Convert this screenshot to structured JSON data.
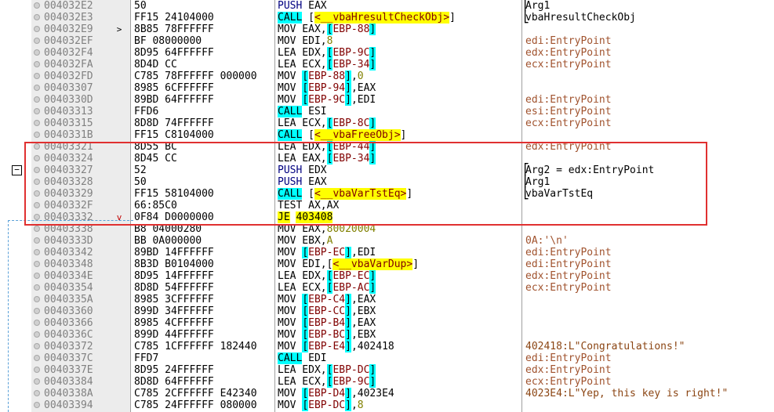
{
  "rows": [
    {
      "addr": "004032E2",
      "marker": "",
      "bytes": "50",
      "instr": [
        [
          "k-push",
          "PUSH"
        ],
        [
          "p",
          " EAX"
        ]
      ],
      "comment": "Arg1",
      "ctype": "arg",
      "brace": "top"
    },
    {
      "addr": "004032E3",
      "marker": "",
      "bytes": "FF15 24104000",
      "instr": [
        [
          "k-call",
          "CALL"
        ],
        [
          "p",
          " ["
        ],
        [
          "op-call",
          "<__vbaHresultCheckObj>"
        ],
        [
          "p",
          "]"
        ]
      ],
      "comment": "vbaHresultCheckObj",
      "ctype": "arg",
      "brace": "bottom"
    },
    {
      "addr": "004032E9",
      "marker": ">",
      "bytes": "8B85 78FFFFFF",
      "instr": [
        [
          "k-mov",
          "MOV"
        ],
        [
          "p",
          " EAX,"
        ],
        [
          "op-mem",
          "["
        ],
        [
          "op-ref",
          "EBP-88"
        ],
        [
          "op-mem",
          "]"
        ]
      ],
      "comment": "",
      "ctype": "reg"
    },
    {
      "addr": "004032EF",
      "marker": "",
      "bytes": "BF 08000000",
      "instr": [
        [
          "k-mov",
          "MOV"
        ],
        [
          "p",
          " EDI,"
        ],
        [
          "op-num",
          "8"
        ]
      ],
      "comment": "edi:EntryPoint",
      "ctype": "reg"
    },
    {
      "addr": "004032F4",
      "marker": "",
      "bytes": "8D95 64FFFFFF",
      "instr": [
        [
          "k-lea",
          "LEA"
        ],
        [
          "p",
          " EDX,"
        ],
        [
          "op-mem",
          "["
        ],
        [
          "op-ref",
          "EBP-9C"
        ],
        [
          "op-mem",
          "]"
        ]
      ],
      "comment": "edx:EntryPoint",
      "ctype": "reg"
    },
    {
      "addr": "004032FA",
      "marker": "",
      "bytes": "8D4D CC",
      "instr": [
        [
          "k-lea",
          "LEA"
        ],
        [
          "p",
          " ECX,"
        ],
        [
          "op-mem",
          "["
        ],
        [
          "op-ref",
          "EBP-34"
        ],
        [
          "op-mem",
          "]"
        ]
      ],
      "comment": "ecx:EntryPoint",
      "ctype": "reg"
    },
    {
      "addr": "004032FD",
      "marker": "",
      "bytes": "C785 78FFFFFF 000000",
      "instr": [
        [
          "k-mov",
          "MOV"
        ],
        [
          "p",
          " "
        ],
        [
          "op-mem",
          "["
        ],
        [
          "op-ref",
          "EBP-88"
        ],
        [
          "op-mem",
          "]"
        ],
        [
          "p",
          ","
        ],
        [
          "op-num",
          "0"
        ]
      ],
      "comment": "",
      "ctype": "reg"
    },
    {
      "addr": "00403307",
      "marker": "",
      "bytes": "8985 6CFFFFFF",
      "instr": [
        [
          "k-mov",
          "MOV"
        ],
        [
          "p",
          " "
        ],
        [
          "op-mem",
          "["
        ],
        [
          "op-ref",
          "EBP-94"
        ],
        [
          "op-mem",
          "]"
        ],
        [
          "p",
          ",EAX"
        ]
      ],
      "comment": "",
      "ctype": "reg"
    },
    {
      "addr": "0040330D",
      "marker": "",
      "bytes": "89BD 64FFFFFF",
      "instr": [
        [
          "k-mov",
          "MOV"
        ],
        [
          "p",
          " "
        ],
        [
          "op-mem",
          "["
        ],
        [
          "op-ref",
          "EBP-9C"
        ],
        [
          "op-mem",
          "]"
        ],
        [
          "p",
          ",EDI"
        ]
      ],
      "comment": "edi:EntryPoint",
      "ctype": "reg"
    },
    {
      "addr": "00403313",
      "marker": "",
      "bytes": "FFD6",
      "instr": [
        [
          "k-call",
          "CALL"
        ],
        [
          "p",
          " ESI"
        ]
      ],
      "comment": "esi:EntryPoint",
      "ctype": "reg"
    },
    {
      "addr": "00403315",
      "marker": "",
      "bytes": "8D8D 74FFFFFF",
      "instr": [
        [
          "k-lea",
          "LEA"
        ],
        [
          "p",
          " ECX,"
        ],
        [
          "op-mem",
          "["
        ],
        [
          "op-ref",
          "EBP-8C"
        ],
        [
          "op-mem",
          "]"
        ]
      ],
      "comment": "ecx:EntryPoint",
      "ctype": "reg"
    },
    {
      "addr": "0040331B",
      "marker": "",
      "bytes": "FF15 C8104000",
      "instr": [
        [
          "k-call",
          "CALL"
        ],
        [
          "p",
          " ["
        ],
        [
          "op-call",
          "<__vbaFreeObj>"
        ],
        [
          "p",
          "]"
        ]
      ],
      "comment": "",
      "ctype": "reg"
    },
    {
      "addr": "00403321",
      "marker": "",
      "bytes": "8D55 BC",
      "instr": [
        [
          "k-lea",
          "LEA"
        ],
        [
          "p",
          " EDX,"
        ],
        [
          "op-mem",
          "["
        ],
        [
          "op-ref",
          "EBP-44"
        ],
        [
          "op-mem",
          "]"
        ]
      ],
      "comment": "edx:EntryPoint",
      "ctype": "reg"
    },
    {
      "addr": "00403324",
      "marker": "",
      "bytes": "8D45 CC",
      "instr": [
        [
          "k-lea",
          "LEA"
        ],
        [
          "p",
          " EAX,"
        ],
        [
          "op-mem",
          "["
        ],
        [
          "op-ref",
          "EBP-34"
        ],
        [
          "op-mem",
          "]"
        ]
      ],
      "comment": "",
      "ctype": "reg"
    },
    {
      "addr": "00403327",
      "marker": "",
      "bytes": "52",
      "instr": [
        [
          "k-push",
          "PUSH"
        ],
        [
          "p",
          " EDX"
        ]
      ],
      "comment": "Arg2 = edx:EntryPoint",
      "ctype": "arg",
      "brace": "top"
    },
    {
      "addr": "00403328",
      "marker": "",
      "bytes": "50",
      "instr": [
        [
          "k-push",
          "PUSH"
        ],
        [
          "p",
          " EAX"
        ]
      ],
      "comment": "Arg1",
      "ctype": "arg",
      "brace": "mid"
    },
    {
      "addr": "00403329",
      "marker": "",
      "bytes": "FF15 58104000",
      "instr": [
        [
          "k-call",
          "CALL"
        ],
        [
          "p",
          " ["
        ],
        [
          "op-call",
          "<__vbaVarTstEq>"
        ],
        [
          "p",
          "]"
        ]
      ],
      "comment": "vbaVarTstEq",
      "ctype": "arg",
      "brace": "bottom"
    },
    {
      "addr": "0040332F",
      "marker": "",
      "bytes": "66:85C0",
      "instr": [
        [
          "k-test",
          "TEST"
        ],
        [
          "p",
          " AX,AX"
        ]
      ],
      "comment": "",
      "ctype": "reg"
    },
    {
      "addr": "00403332",
      "marker": "v",
      "bytes": "0F84 D0000000",
      "instr": [
        [
          "k-je",
          "JE"
        ],
        [
          "p",
          " "
        ],
        [
          "op-jaddr",
          "403408"
        ]
      ],
      "comment": "",
      "ctype": "reg"
    },
    {
      "addr": "00403338",
      "marker": "",
      "bytes": "B8 04000280",
      "instr": [
        [
          "k-mov",
          "MOV"
        ],
        [
          "p",
          " EAX,"
        ],
        [
          "op-num",
          "80020004"
        ]
      ],
      "comment": "",
      "ctype": "reg"
    },
    {
      "addr": "0040333D",
      "marker": "",
      "bytes": "BB 0A000000",
      "instr": [
        [
          "k-mov",
          "MOV"
        ],
        [
          "p",
          " EBX,"
        ],
        [
          "op-num",
          "A"
        ]
      ],
      "comment": "0A:'\\n'",
      "ctype": "reg"
    },
    {
      "addr": "00403342",
      "marker": "",
      "bytes": "89BD 14FFFFFF",
      "instr": [
        [
          "k-mov",
          "MOV"
        ],
        [
          "p",
          " "
        ],
        [
          "op-mem",
          "["
        ],
        [
          "op-ref",
          "EBP-EC"
        ],
        [
          "op-mem",
          "]"
        ],
        [
          "p",
          ",EDI"
        ]
      ],
      "comment": "edi:EntryPoint",
      "ctype": "reg"
    },
    {
      "addr": "00403348",
      "marker": "",
      "bytes": "8B3D B0104000",
      "instr": [
        [
          "k-mov",
          "MOV"
        ],
        [
          "p",
          " EDI,["
        ],
        [
          "op-call",
          "<__vbaVarDup>"
        ],
        [
          "p",
          "]"
        ]
      ],
      "comment": "edi:EntryPoint",
      "ctype": "reg"
    },
    {
      "addr": "0040334E",
      "marker": "",
      "bytes": "8D95 14FFFFFF",
      "instr": [
        [
          "k-lea",
          "LEA"
        ],
        [
          "p",
          " EDX,"
        ],
        [
          "op-mem",
          "["
        ],
        [
          "op-ref",
          "EBP-EC"
        ],
        [
          "op-mem",
          "]"
        ]
      ],
      "comment": "edx:EntryPoint",
      "ctype": "reg"
    },
    {
      "addr": "00403354",
      "marker": "",
      "bytes": "8D8D 54FFFFFF",
      "instr": [
        [
          "k-lea",
          "LEA"
        ],
        [
          "p",
          " ECX,"
        ],
        [
          "op-mem",
          "["
        ],
        [
          "op-ref",
          "EBP-AC"
        ],
        [
          "op-mem",
          "]"
        ]
      ],
      "comment": "ecx:EntryPoint",
      "ctype": "reg"
    },
    {
      "addr": "0040335A",
      "marker": "",
      "bytes": "8985 3CFFFFFF",
      "instr": [
        [
          "k-mov",
          "MOV"
        ],
        [
          "p",
          " "
        ],
        [
          "op-mem",
          "["
        ],
        [
          "op-ref",
          "EBP-C4"
        ],
        [
          "op-mem",
          "]"
        ],
        [
          "p",
          ",EAX"
        ]
      ],
      "comment": "",
      "ctype": "reg"
    },
    {
      "addr": "00403360",
      "marker": "",
      "bytes": "899D 34FFFFFF",
      "instr": [
        [
          "k-mov",
          "MOV"
        ],
        [
          "p",
          " "
        ],
        [
          "op-mem",
          "["
        ],
        [
          "op-ref",
          "EBP-CC"
        ],
        [
          "op-mem",
          "]"
        ],
        [
          "p",
          ",EBX"
        ]
      ],
      "comment": "",
      "ctype": "reg"
    },
    {
      "addr": "00403366",
      "marker": "",
      "bytes": "8985 4CFFFFFF",
      "instr": [
        [
          "k-mov",
          "MOV"
        ],
        [
          "p",
          " "
        ],
        [
          "op-mem",
          "["
        ],
        [
          "op-ref",
          "EBP-B4"
        ],
        [
          "op-mem",
          "]"
        ],
        [
          "p",
          ",EAX"
        ]
      ],
      "comment": "",
      "ctype": "reg"
    },
    {
      "addr": "0040336C",
      "marker": "",
      "bytes": "899D 44FFFFFF",
      "instr": [
        [
          "k-mov",
          "MOV"
        ],
        [
          "p",
          " "
        ],
        [
          "op-mem",
          "["
        ],
        [
          "op-ref",
          "EBP-BC"
        ],
        [
          "op-mem",
          "]"
        ],
        [
          "p",
          ",EBX"
        ]
      ],
      "comment": "",
      "ctype": "reg"
    },
    {
      "addr": "00403372",
      "marker": "",
      "bytes": "C785 1CFFFFFF 182440",
      "instr": [
        [
          "k-mov",
          "MOV"
        ],
        [
          "p",
          " "
        ],
        [
          "op-mem",
          "["
        ],
        [
          "op-ref",
          "EBP-E4"
        ],
        [
          "op-mem",
          "]"
        ],
        [
          "p",
          ",402418"
        ]
      ],
      "comment": "402418:L\"Congratulations!\"",
      "ctype": "str"
    },
    {
      "addr": "0040337C",
      "marker": "",
      "bytes": "FFD7",
      "instr": [
        [
          "k-call",
          "CALL"
        ],
        [
          "p",
          " EDI"
        ]
      ],
      "comment": "edi:EntryPoint",
      "ctype": "reg"
    },
    {
      "addr": "0040337E",
      "marker": "",
      "bytes": "8D95 24FFFFFF",
      "instr": [
        [
          "k-lea",
          "LEA"
        ],
        [
          "p",
          " EDX,"
        ],
        [
          "op-mem",
          "["
        ],
        [
          "op-ref",
          "EBP-DC"
        ],
        [
          "op-mem",
          "]"
        ]
      ],
      "comment": "edx:EntryPoint",
      "ctype": "reg"
    },
    {
      "addr": "00403384",
      "marker": "",
      "bytes": "8D8D 64FFFFFF",
      "instr": [
        [
          "k-lea",
          "LEA"
        ],
        [
          "p",
          " ECX,"
        ],
        [
          "op-mem",
          "["
        ],
        [
          "op-ref",
          "EBP-9C"
        ],
        [
          "op-mem",
          "]"
        ]
      ],
      "comment": "ecx:EntryPoint",
      "ctype": "reg"
    },
    {
      "addr": "0040338A",
      "marker": "",
      "bytes": "C785 2CFFFFFF E42340",
      "instr": [
        [
          "k-mov",
          "MOV"
        ],
        [
          "p",
          " "
        ],
        [
          "op-mem",
          "["
        ],
        [
          "op-ref",
          "EBP-D4"
        ],
        [
          "op-mem",
          "]"
        ],
        [
          "p",
          ",4023E4"
        ]
      ],
      "comment": "4023E4:L\"Yep, this key is right!\"",
      "ctype": "str"
    },
    {
      "addr": "00403394",
      "marker": "",
      "bytes": "C785 24FFFFFF 080000",
      "instr": [
        [
          "k-mov",
          "MOV"
        ],
        [
          "p",
          " "
        ],
        [
          "op-mem",
          "["
        ],
        [
          "op-ref",
          "EBP-DC"
        ],
        [
          "op-mem",
          "]"
        ],
        [
          "p",
          ","
        ],
        [
          "op-num",
          "8"
        ]
      ],
      "comment": "",
      "ctype": "reg"
    }
  ],
  "collapse_symbol": "−"
}
